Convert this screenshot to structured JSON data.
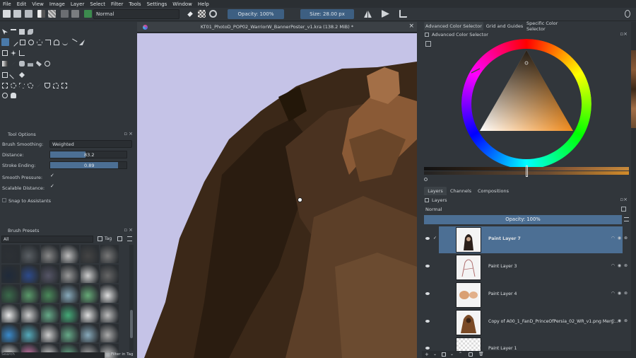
{
  "menubar": {
    "items": [
      "File",
      "Edit",
      "View",
      "Image",
      "Layer",
      "Select",
      "Filter",
      "Tools",
      "Settings",
      "Window",
      "Help"
    ]
  },
  "toolbar": {
    "blend_mode": "Normal",
    "opacity": "Opacity: 100%",
    "size": "Size: 28.00 px"
  },
  "tool_options": {
    "title": "Tool Options",
    "brush_smoothing_label": "Brush Smoothing:",
    "brush_smoothing_value": "Weighted",
    "distance_label": "Distance:",
    "distance_value": "83.2",
    "distance_fraction": 0.46,
    "stroke_ending_label": "Stroke Ending:",
    "stroke_ending_value": "0.89",
    "stroke_ending_fraction": 0.89,
    "smooth_pressure_label": "Smooth Pressure:",
    "scalable_distance_label": "Scalable Distance:",
    "snap_label": "Snap to Assistants",
    "check_mark": "✓"
  },
  "brush_presets": {
    "title": "Brush Presets",
    "filter_value": "All",
    "tag_label": "Tag",
    "search_placeholder": "Search",
    "filter_in_tag": "Filter in Tag"
  },
  "document": {
    "tab_title": "KT01_PhotoD_POP02_WarriorW_BannerPoster_v1.kra (138.2 MiB) *",
    "close_glyph": "×"
  },
  "color_panel": {
    "tabs": [
      "Advanced Color Selector",
      "Grid and Guides",
      "Specific Color Selector"
    ],
    "subtitle": "Advanced Color Selector"
  },
  "layers_panel": {
    "tabs": [
      "Layers",
      "Channels",
      "Compositions"
    ],
    "title": "Layers",
    "blend_mode": "Normal",
    "opacity": "Opacity:  100%",
    "layers": [
      {
        "name": "Paint Layer 7",
        "selected": true
      },
      {
        "name": "Paint Layer 3",
        "selected": false
      },
      {
        "name": "Paint Layer 4",
        "selected": false
      },
      {
        "name": "Copy of A00_1_FanD_PrinceOfPersia_02_WR_v1.png Merg...",
        "selected": false
      },
      {
        "name": "Paint Layer 1",
        "selected": false
      }
    ]
  },
  "colors": {
    "accent": "#3d5f82",
    "selected_layer": "#4c6f94",
    "canvas_bg": "#c5c3e7",
    "rock_dark": "#3a2717",
    "rock_light": "#8a5a36"
  }
}
